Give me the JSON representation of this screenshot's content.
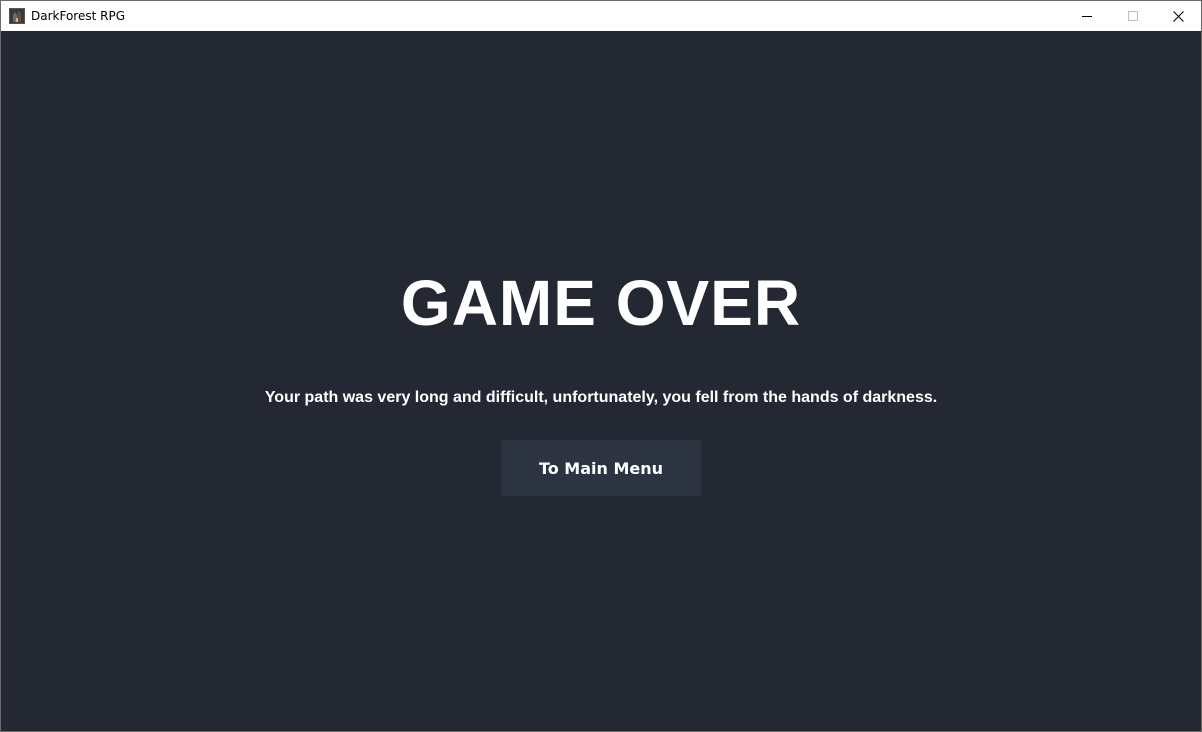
{
  "window": {
    "title": "DarkForest RPG",
    "icon": "app-logo-icon",
    "controls": {
      "minimize": "minimize-icon",
      "maximize": "maximize-icon",
      "close": "close-icon"
    }
  },
  "screen": {
    "headline": "GAME OVER",
    "message": "Your path was very long and difficult, unfortunately, you fell from the hands of darkness.",
    "main_menu_label": "To Main Menu"
  },
  "colors": {
    "background": "#232833",
    "button": "#2c3441",
    "text": "#ffffff"
  }
}
